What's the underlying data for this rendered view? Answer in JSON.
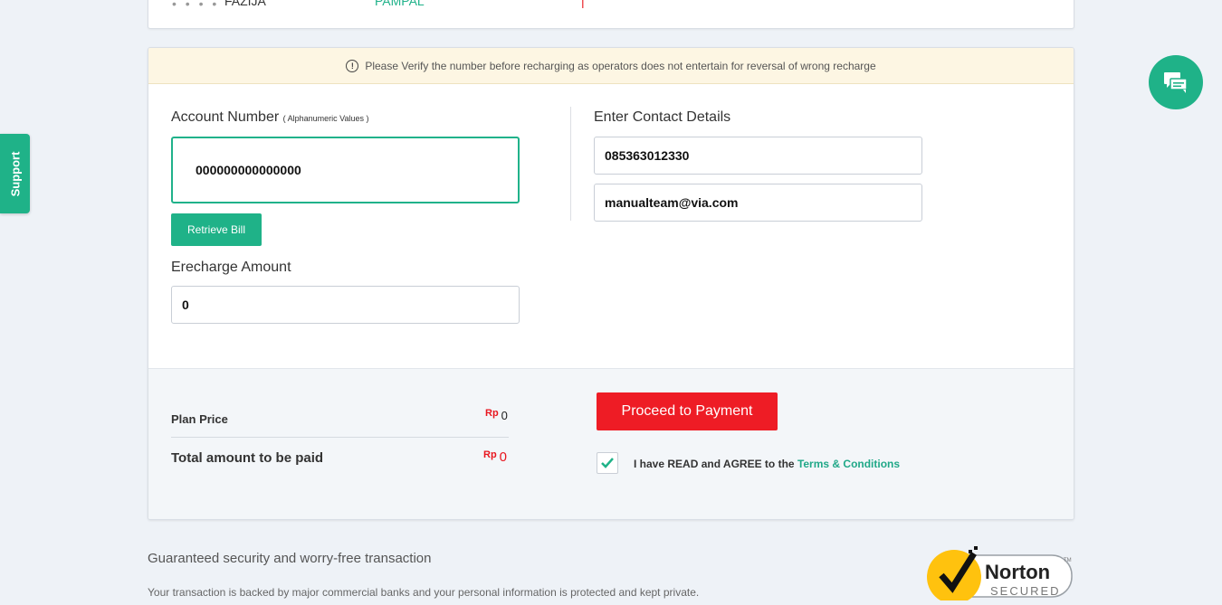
{
  "top_card": {
    "frag_name": "FAZIJA",
    "frag_status": "PAMPAL"
  },
  "warning": {
    "text": "Please Verify the number before recharging as operators does not entertain for reversal of wrong recharge"
  },
  "form": {
    "account_label": "Account Number",
    "account_hint": "( Alphanumeric Values )",
    "account_value": "000000000000000",
    "retrieve_label": "Retrieve Bill",
    "amount_label": "Erecharge Amount",
    "amount_value": "0",
    "contact_label": "Enter Contact Details",
    "phone_value": "085363012330",
    "email_value": "manualteam@via.com"
  },
  "summary": {
    "currency": "Rp",
    "plan_price_label": "Plan Price",
    "plan_price_value": "0",
    "total_label": "Total amount to be paid",
    "total_value": "0",
    "pay_label": "Proceed to Payment",
    "agree_text": "I have READ and AGREE to the",
    "terms_link": "Terms & Conditions",
    "agree_checked": true
  },
  "support": {
    "label": "Support"
  },
  "guarantee": {
    "title": "Guaranteed security and worry-free transaction",
    "subtitle": "Your transaction is backed by major commercial banks and your personal information is protected and kept private."
  },
  "norton": {
    "brand": "Norton",
    "tag": "SECURED",
    "tm": "TM"
  },
  "colors": {
    "accent": "#1fb288",
    "pay": "#ee1c25",
    "currency": "#e8161f",
    "warning_bg": "#fdf6e3"
  }
}
